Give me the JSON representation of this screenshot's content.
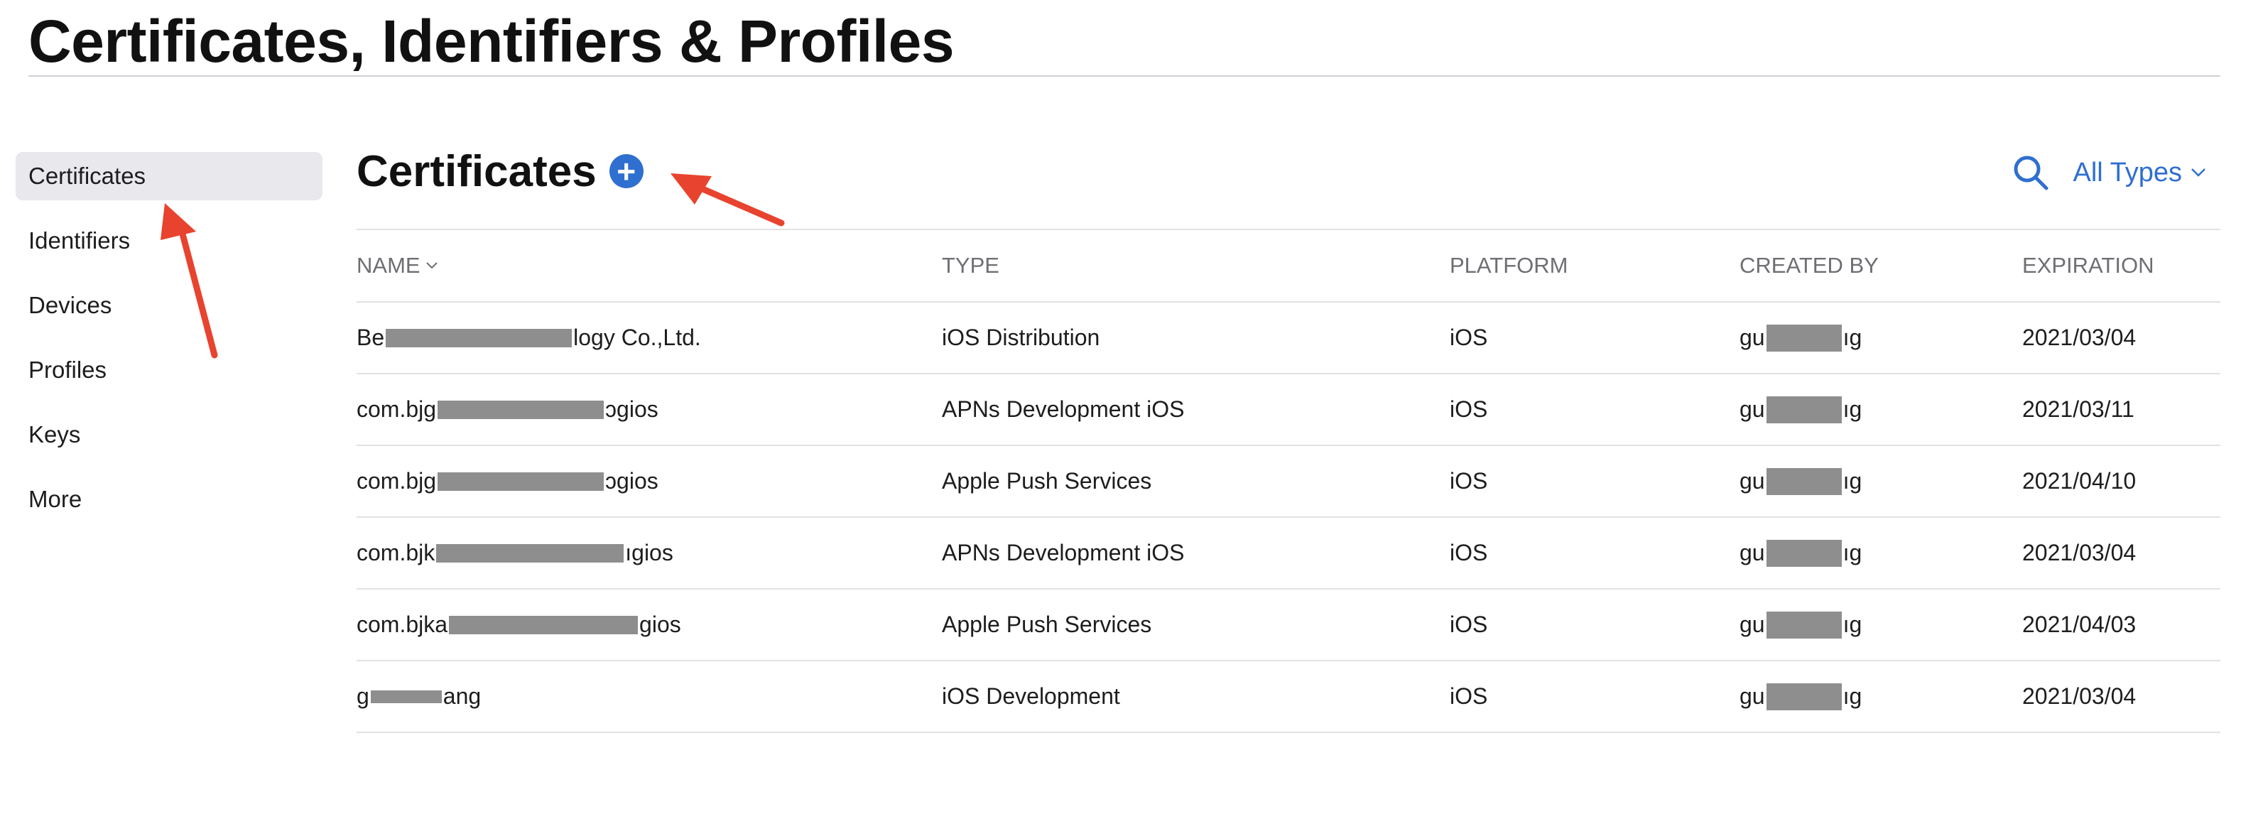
{
  "page": {
    "title": "Certificates, Identifiers & Profiles"
  },
  "sidebar": {
    "items": [
      {
        "label": "Certificates",
        "active": true
      },
      {
        "label": "Identifiers"
      },
      {
        "label": "Devices"
      },
      {
        "label": "Profiles"
      },
      {
        "label": "Keys"
      },
      {
        "label": "More"
      }
    ]
  },
  "section": {
    "title": "Certificates",
    "add_icon": "plus-circle-icon",
    "search_icon": "search-icon",
    "filter_label": "All Types"
  },
  "table": {
    "columns": [
      "NAME",
      "TYPE",
      "PLATFORM",
      "CREATED BY",
      "EXPIRATION"
    ],
    "rows": [
      {
        "name_prefix": "Be",
        "name_suffix": "logy Co.,Ltd.",
        "type": "iOS Distribution",
        "platform": "iOS",
        "created_prefix": "gu",
        "created_suffix": "ıg",
        "expiration": "2021/03/04"
      },
      {
        "name_prefix": "com.bjg",
        "name_suffix": "ɔgios",
        "type": "APNs Development iOS",
        "platform": "iOS",
        "created_prefix": "gu",
        "created_suffix": "ıg",
        "expiration": "2021/03/11"
      },
      {
        "name_prefix": "com.bjg",
        "name_suffix": "ɔgios",
        "type": "Apple Push Services",
        "platform": "iOS",
        "created_prefix": "gu",
        "created_suffix": "ıg",
        "expiration": "2021/04/10"
      },
      {
        "name_prefix": "com.bjk",
        "name_suffix": "ıgios",
        "type": "APNs Development iOS",
        "platform": "iOS",
        "created_prefix": "gu",
        "created_suffix": "ıg",
        "expiration": "2021/03/04"
      },
      {
        "name_prefix": "com.bjka",
        "name_suffix": "gios",
        "type": "Apple Push Services",
        "platform": "iOS",
        "created_prefix": "gu",
        "created_suffix": "ıg",
        "expiration": "2021/04/03"
      },
      {
        "name_prefix": "g",
        "name_suffix": "ang",
        "type": "iOS Development",
        "platform": "iOS",
        "created_prefix": "gu",
        "created_suffix": "ıg",
        "expiration": "2021/03/04"
      }
    ]
  },
  "colors": {
    "accent": "#2f6fd0",
    "annotation_arrow": "#e8432e",
    "redaction": "#8e8e8e"
  }
}
